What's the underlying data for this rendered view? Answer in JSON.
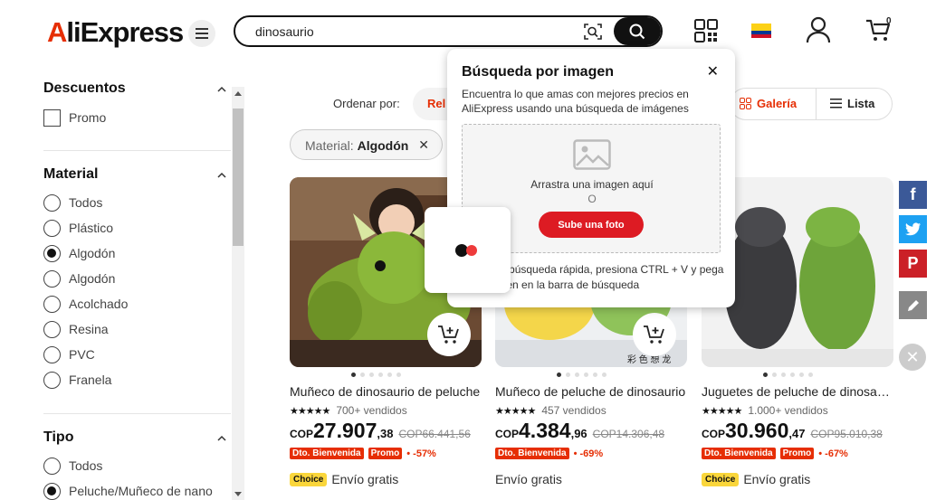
{
  "header": {
    "logo": "AliExpress",
    "search_value": "dinosaurio",
    "cart_count": "0"
  },
  "sidebar": {
    "descuentos": {
      "title": "Descuentos",
      "option": "Promo"
    },
    "material": {
      "title": "Material",
      "options": [
        "Todos",
        "Plástico",
        "Algodón",
        "Algodón",
        "Acolchado",
        "Resina",
        "PVC",
        "Franela"
      ],
      "selected_index": 2
    },
    "tipo": {
      "title": "Tipo",
      "options": [
        "Todos",
        "Peluche/Muñeco de nano"
      ],
      "selected_index": 1
    }
  },
  "toolbar": {
    "sort_label": "Ordenar por:",
    "sort_active": "Rel",
    "view_gallery": "Galería",
    "view_list": "Lista"
  },
  "filter_chip": {
    "prefix": "Material:",
    "value": "Algodón"
  },
  "products": [
    {
      "title": "Muñeco de dinosaurio de peluche",
      "sold": "700+ vendidos",
      "currency": "COP",
      "price_int": "27.907",
      "price_dec": ",38",
      "old_price": "COP66.441,56",
      "badge1": "Dto. Bienvenida",
      "badge2": "Promo",
      "discount": "• -57%",
      "choice": "Choice",
      "shipping": "Envío gratis"
    },
    {
      "title": "Muñeco de peluche de dinosaurio",
      "sold": "457 vendidos",
      "currency": "COP",
      "price_int": "4.384",
      "price_dec": ",96",
      "old_price": "COP14.306,48",
      "badge1": "Dto. Bienvenida",
      "discount": "• -69%",
      "shipping": "Envío gratis",
      "watermark": "彩 色 想 龙"
    },
    {
      "title": "Juguetes de peluche de dinosaurio",
      "sold": "1.000+ vendidos",
      "currency": "COP",
      "price_int": "30.960",
      "price_dec": ",47",
      "old_price": "COP95.010,38",
      "badge1": "Dto. Bienvenida",
      "badge2": "Promo",
      "discount": "• -67%",
      "choice": "Choice",
      "shipping": "Envío gratis"
    }
  ],
  "popup": {
    "title": "Búsqueda por imagen",
    "description": "Encuentra lo que amas con mejores precios en AliExpress usando una búsqueda de imágenes",
    "drop_text": "Arrastra una imagen aquí",
    "or_text": "O",
    "upload_button": "Sube una foto",
    "tip": "Para una búsqueda rápida, presiona CTRL + V y pega una imagen en la barra de búsqueda"
  },
  "colors": {
    "accent": "#e62e04",
    "facebook": "#3b5998",
    "twitter": "#1da1f2",
    "pinterest": "#cb2027"
  }
}
